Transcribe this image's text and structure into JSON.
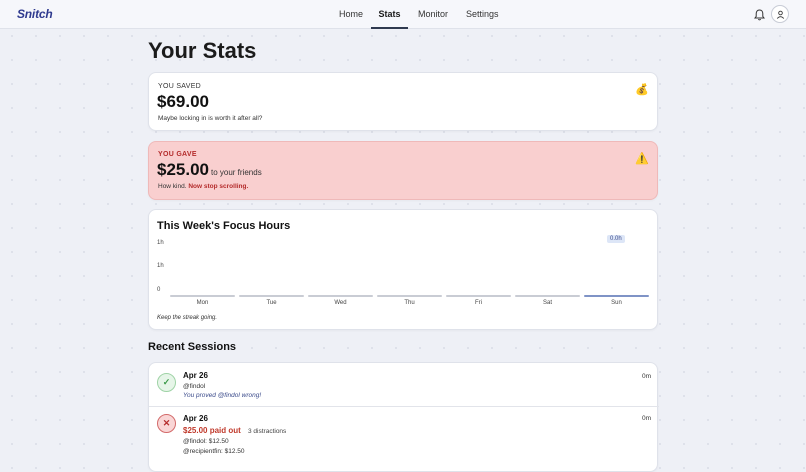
{
  "app": {
    "logo": "Snitch"
  },
  "nav": {
    "items": [
      "Home",
      "Stats",
      "Monitor",
      "Settings"
    ],
    "active": "Stats"
  },
  "page": {
    "title": "Your Stats"
  },
  "saved": {
    "label": "YOU SAVED",
    "amount": "$69.00",
    "note": "Maybe locking in is worth it after all?",
    "emoji": "💰"
  },
  "gave": {
    "label": "YOU GAVE",
    "amount": "$25.00",
    "suffix": "to your friends",
    "note_prefix": "How kind. ",
    "note_strong": "Now stop scrolling.",
    "emoji": "⚠️"
  },
  "chart_data": {
    "type": "bar",
    "title": "This Week's Focus Hours",
    "categories": [
      "Mon",
      "Tue",
      "Wed",
      "Thu",
      "Fri",
      "Sat",
      "Sun"
    ],
    "values": [
      0,
      0,
      0,
      0,
      0,
      0,
      0
    ],
    "highlight": "Sun",
    "highlight_value_label": "0.0h",
    "y_tick_labels": [
      "1h",
      "1h",
      "0"
    ],
    "xlabel": "",
    "ylabel": "",
    "grid": false,
    "footer": "Keep the streak going."
  },
  "sessions": {
    "title": "Recent Sessions",
    "items": [
      {
        "status": "success",
        "icon": "check-icon",
        "date": "Apr 26",
        "handle": "@findol",
        "message": "You proved @findol wrong!",
        "duration": "0m"
      },
      {
        "status": "fail",
        "icon": "close-icon",
        "date": "Apr 26",
        "paid": "$25.00 paid out",
        "distractions": "3 distractions",
        "payouts": [
          "@findol: $12.50",
          "@recipientfin: $12.50"
        ],
        "duration": "0m"
      }
    ]
  },
  "colors": {
    "brand": "#2f3a8f",
    "gave_bg": "#f9cfcf",
    "danger": "#c0392b",
    "success": "#3c9a4a"
  }
}
